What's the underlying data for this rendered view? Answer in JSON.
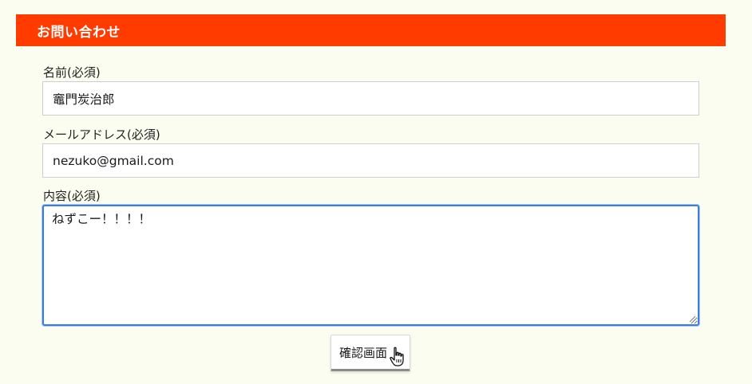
{
  "header": {
    "title": "お問い合わせ"
  },
  "form": {
    "name_label": "名前(必須)",
    "name_value": "竈門炭治郎",
    "email_label": "メールアドレス(必須)",
    "email_value": "nezuko@gmail.com",
    "content_label": "内容(必須)",
    "content_value": "ねずこー！！！！",
    "confirm_label": "確認画面"
  },
  "colors": {
    "header_bg": "#ff3b00",
    "page_bg": "#fbfdf1",
    "focus_border": "#3b7de0"
  },
  "icons": {
    "cursor": "hand-pointer-icon",
    "resize": "resize-handle-icon"
  }
}
